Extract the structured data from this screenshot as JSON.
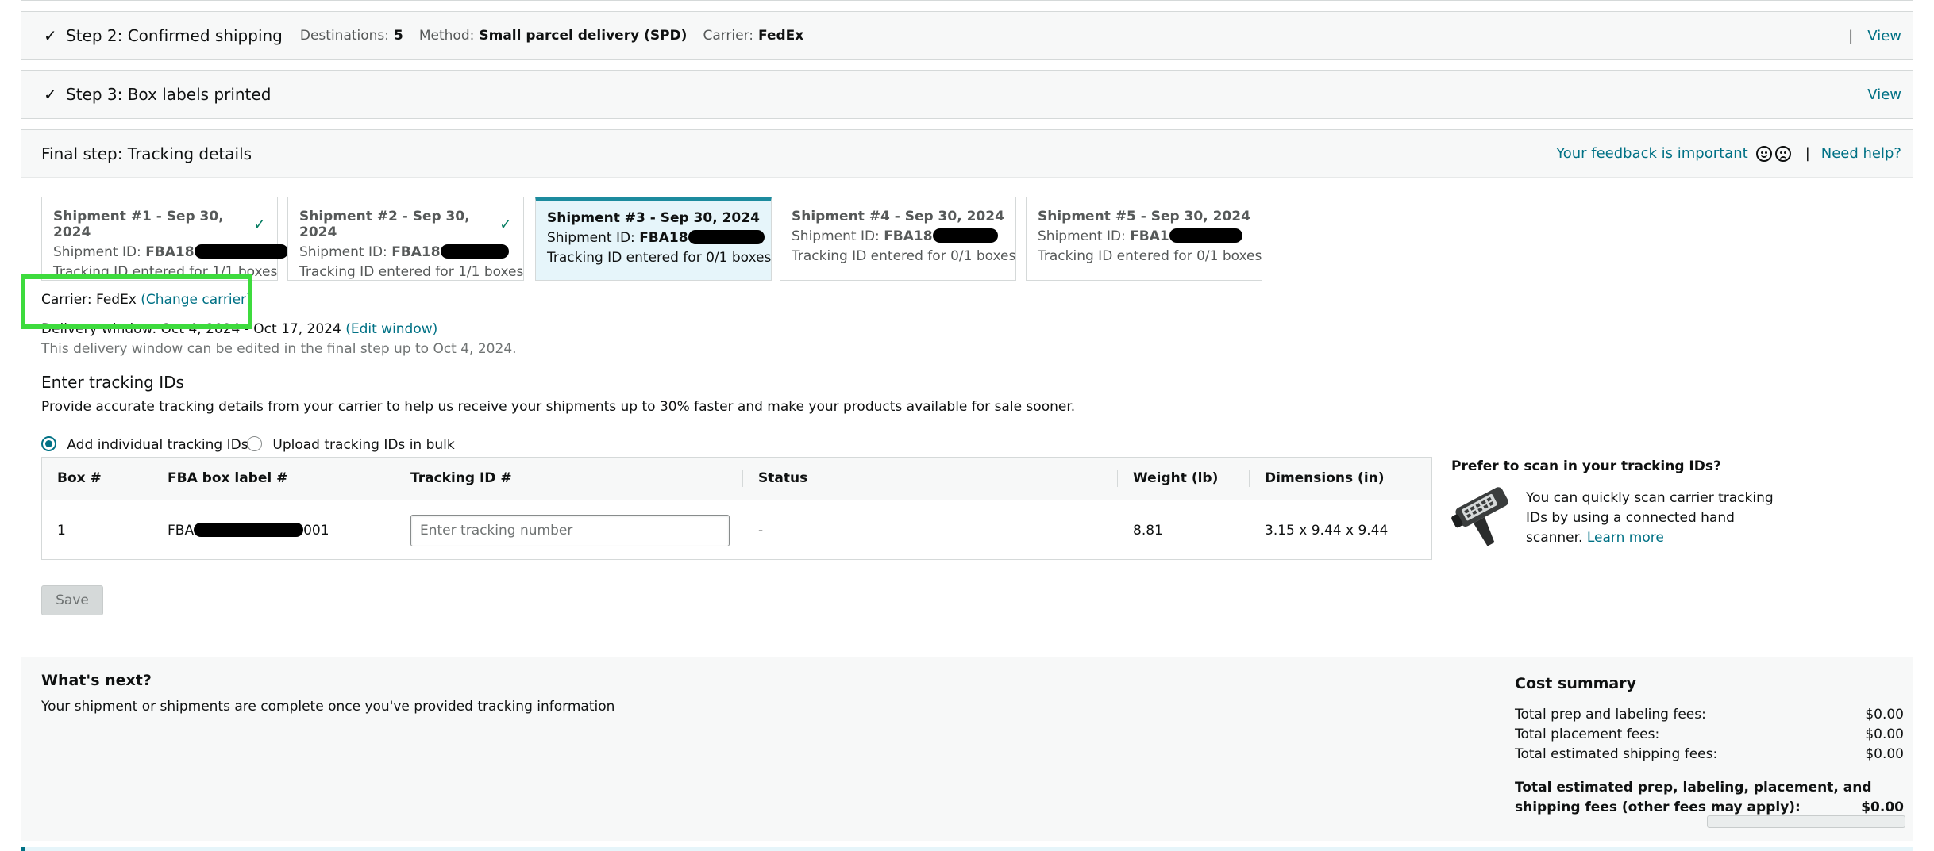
{
  "step2": {
    "title": "Step 2: Confirmed shipping",
    "destinations_label": "Destinations:",
    "destinations_value": "5",
    "method_label": "Method:",
    "method_value": "Small parcel delivery (SPD)",
    "carrier_label": "Carrier:",
    "carrier_value": "FedEx",
    "separator": "|",
    "view_label": "View"
  },
  "step3": {
    "title": "Step 3: Box labels printed",
    "view_label": "View"
  },
  "final": {
    "title": "Final step: Tracking details",
    "feedback_label": "Your feedback is important",
    "separator": "|",
    "help_label": "Need help?"
  },
  "shipments": [
    {
      "title": "Shipment #1 - Sep 30, 2024",
      "id_label": "Shipment ID:",
      "id_prefix": "FBA18",
      "tracking": "Tracking ID entered for 1/1 boxes",
      "done": true
    },
    {
      "title": "Shipment #2 - Sep 30, 2024",
      "id_label": "Shipment ID:",
      "id_prefix": "FBA18",
      "tracking": "Tracking ID entered for 1/1 boxes",
      "done": true
    },
    {
      "title": "Shipment #3 - Sep 30, 2024",
      "id_label": "Shipment ID:",
      "id_prefix": "FBA18",
      "tracking": "Tracking ID entered for 0/1 boxes",
      "done": false
    },
    {
      "title": "Shipment #4 - Sep 30, 2024",
      "id_label": "Shipment ID:",
      "id_prefix": "FBA18",
      "tracking": "Tracking ID entered for 0/1 boxes",
      "done": false
    },
    {
      "title": "Shipment #5 - Sep 30, 2024",
      "id_label": "Shipment ID:",
      "id_prefix": "FBA1",
      "tracking": "Tracking ID entered for 0/1 boxes",
      "done": false
    }
  ],
  "carrier": {
    "label": "Carrier: FedEx",
    "change_label": "(Change carrier)"
  },
  "delivery": {
    "label": "Delivery window: Oct 4, 2024 - Oct 17, 2024",
    "edit_label": "(Edit window)",
    "note": "This delivery window can be edited in the final step up to Oct 4, 2024."
  },
  "tracking_section": {
    "heading": "Enter tracking IDs",
    "description": "Provide accurate tracking details from your carrier to help us receive your shipments up to 30% faster and make your products available for sale sooner.",
    "option_individual": "Add individual tracking IDs",
    "option_bulk": "Upload tracking IDs in bulk"
  },
  "table": {
    "headers": {
      "box": "Box #",
      "label": "FBA box label #",
      "tracking": "Tracking ID #",
      "status": "Status",
      "weight": "Weight (lb)",
      "dimensions": "Dimensions (in)"
    },
    "rows": [
      {
        "box": "1",
        "label_prefix": "FBA",
        "label_suffix": "001",
        "tracking_placeholder": "Enter tracking number",
        "status": "-",
        "weight": "8.81",
        "dimensions": "3.15 x 9.44 x 9.44"
      }
    ]
  },
  "scan": {
    "heading": "Prefer to scan in your tracking IDs?",
    "line1": "You can quickly scan carrier tracking",
    "line2": "IDs by using a connected hand",
    "line3": "scanner.",
    "learn_more": "Learn more"
  },
  "save_label": "Save",
  "whats_next": {
    "heading": "What's next?",
    "text": "Your shipment or shipments are complete once you've provided tracking information"
  },
  "cost_summary": {
    "heading": "Cost summary",
    "rows": [
      {
        "label": "Total prep and labeling fees:",
        "value": "$0.00"
      },
      {
        "label": "Total placement fees:",
        "value": "$0.00"
      },
      {
        "label": "Total estimated shipping fees:",
        "value": "$0.00"
      }
    ],
    "total_line1": "Total estimated prep, labeling, placement, and",
    "total_line2": "shipping fees (other fees may apply):",
    "total_value": "$0.00"
  }
}
